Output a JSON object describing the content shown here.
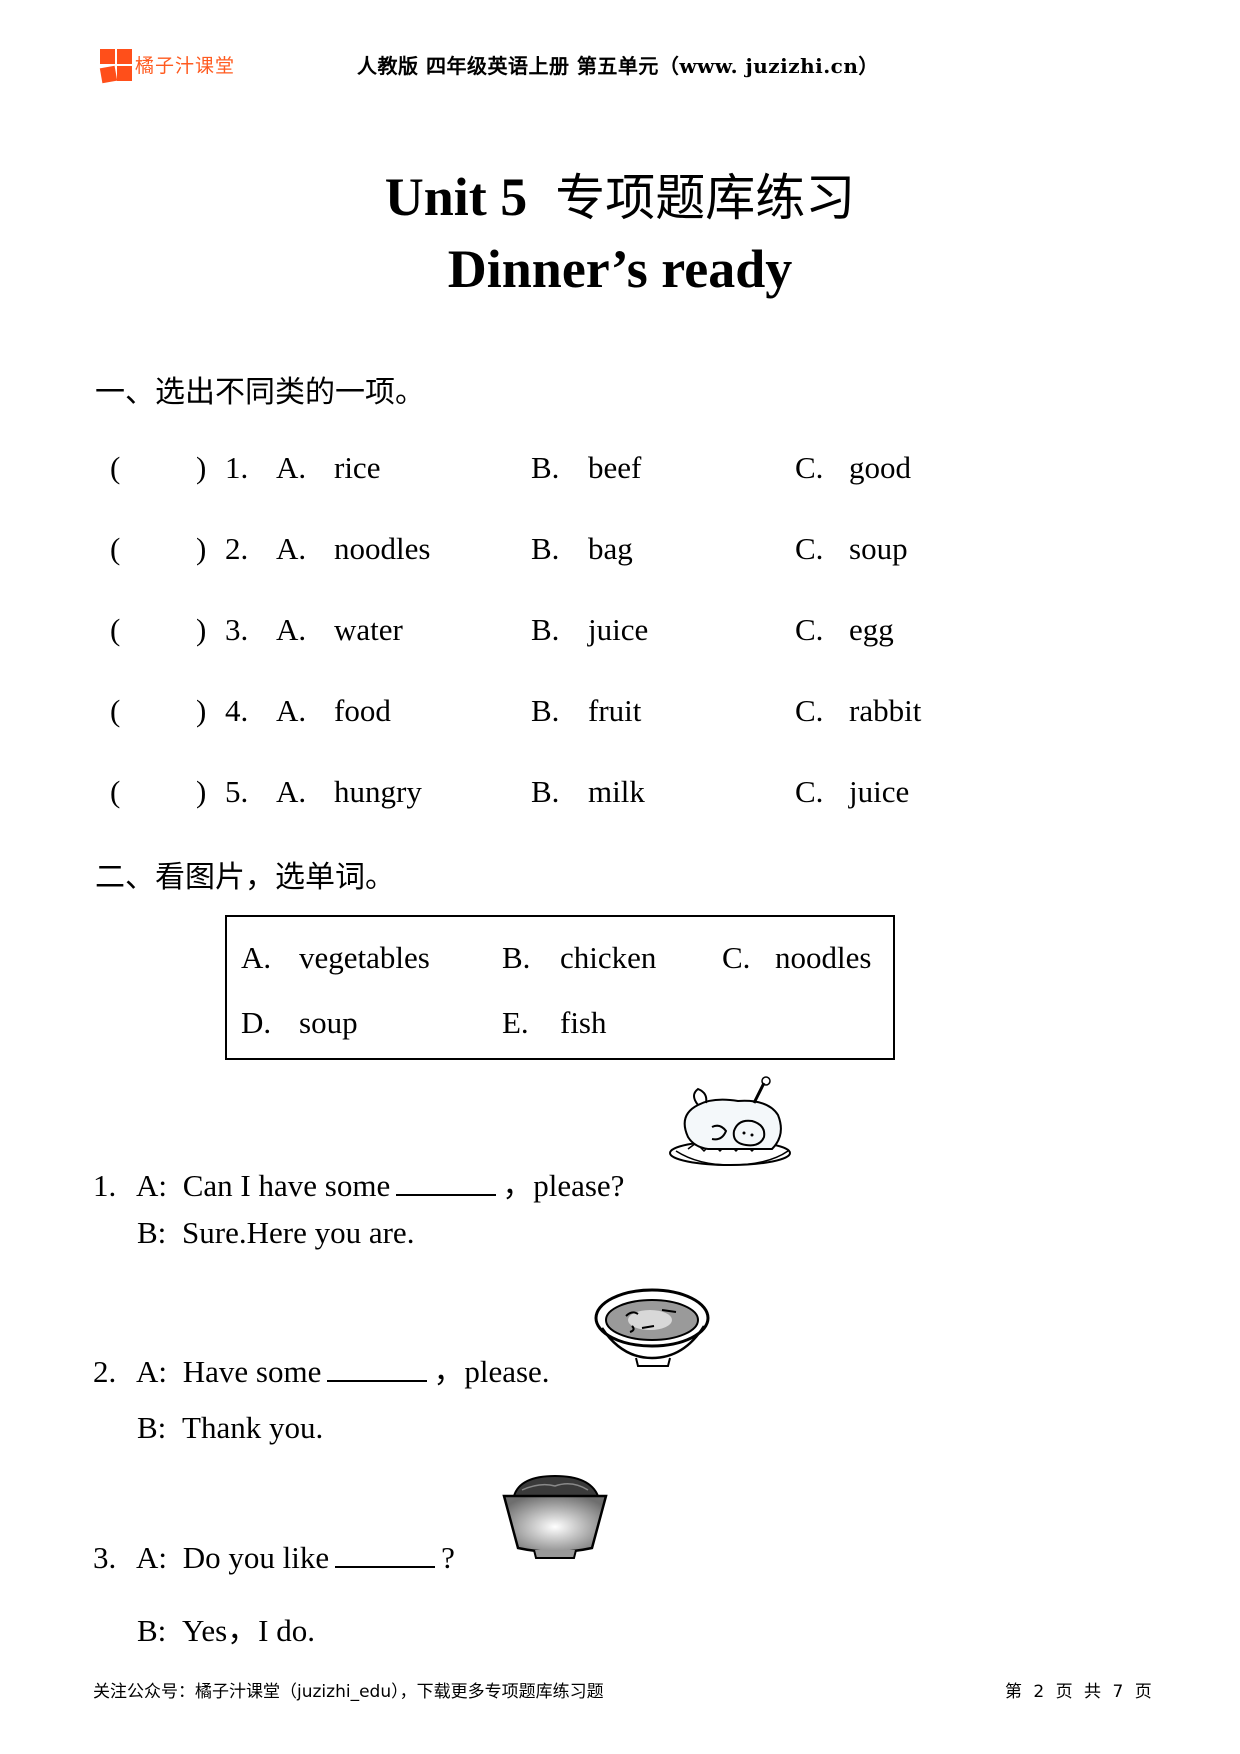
{
  "header": {
    "logo_text": "橘子汁课堂",
    "title": "人教版 四年级英语上册 第五单元（www. juzizhi.cn）"
  },
  "title": {
    "line1_en": "Unit 5",
    "line1_cn": "专项题库练习",
    "line2": "Dinner’s ready"
  },
  "section1": {
    "heading": "一、选出不同类的一项。",
    "questions": [
      {
        "paren_open": "(",
        "paren_close": ")",
        "num": "1.",
        "a_label": "A.",
        "a": "rice",
        "b_label": "B.",
        "b": "beef",
        "c_label": "C.",
        "c": "good"
      },
      {
        "paren_open": "(",
        "paren_close": ")",
        "num": "2.",
        "a_label": "A.",
        "a": "noodles",
        "b_label": "B.",
        "b": "bag",
        "c_label": "C.",
        "c": "soup"
      },
      {
        "paren_open": "(",
        "paren_close": ")",
        "num": "3.",
        "a_label": "A.",
        "a": "water",
        "b_label": "B.",
        "b": "juice",
        "c_label": "C.",
        "c": "egg"
      },
      {
        "paren_open": "(",
        "paren_close": ")",
        "num": "4.",
        "a_label": "A.",
        "a": "food",
        "b_label": "B.",
        "b": "fruit",
        "c_label": "C.",
        "c": "rabbit"
      },
      {
        "paren_open": "(",
        "paren_close": ")",
        "num": "5.",
        "a_label": "A.",
        "a": "hungry",
        "b_label": "B.",
        "b": "milk",
        "c_label": "C.",
        "c": "juice"
      }
    ]
  },
  "section2": {
    "heading": "二、看图片，选单词。",
    "word_bank": [
      {
        "label": "A.",
        "word": "vegetables"
      },
      {
        "label": "B.",
        "word": "chicken"
      },
      {
        "label": "C.",
        "word": "noodles"
      },
      {
        "label": "D.",
        "word": "soup"
      },
      {
        "label": "E.",
        "word": "fish"
      }
    ],
    "dialogues": [
      {
        "num": "1.",
        "a_label": "A:",
        "a_before": "Can I have some",
        "a_after": "，please?",
        "b_label": "B:",
        "b_text": "Sure.Here you are.",
        "picture": "roast-chicken-icon"
      },
      {
        "num": "2.",
        "a_label": "A:",
        "a_before": "Have some",
        "a_after": "，please.",
        "b_label": "B:",
        "b_text": "Thank you.",
        "picture": "soup-bowl-icon"
      },
      {
        "num": "3.",
        "a_label": "A:",
        "a_before": "Do you like",
        "a_after": "?",
        "b_label": "B:",
        "b_text": "Yes，I do.",
        "picture": "noodle-bowl-icon"
      }
    ]
  },
  "footer": {
    "left": "关注公众号：橘子汁课堂（juzizhi_edu），下载更多专项题库练习题",
    "page_prefix": "第",
    "page_current": "2",
    "page_mid": "页 共",
    "page_total": "7",
    "page_suffix": "页"
  },
  "colors": {
    "brand": "#ff4f1a"
  }
}
